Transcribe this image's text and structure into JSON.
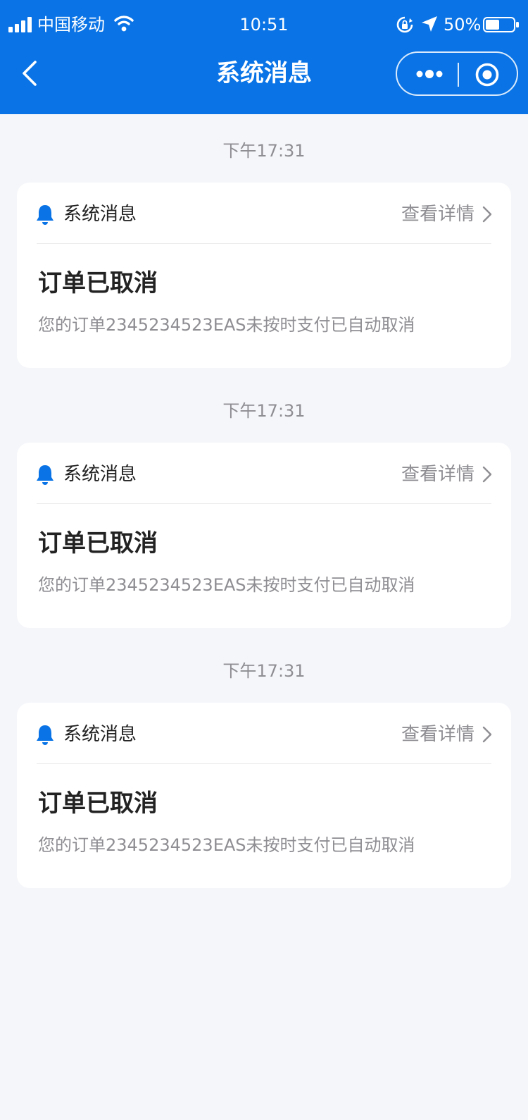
{
  "status_bar": {
    "carrier": "中国移动",
    "time": "10:51",
    "battery": "50%",
    "battery_level": 0.5
  },
  "nav": {
    "title": "系统消息",
    "more_icon": "more-dots-icon",
    "close_icon": "target-icon"
  },
  "colors": {
    "brand": "#0a74e6",
    "background": "#f5f6fa",
    "muted": "#8e8e93"
  },
  "messages": [
    {
      "time": "下午17:31",
      "category": "系统消息",
      "detail_label": "查看详情",
      "heading": "订单已取消",
      "body": "您的订单2345234523EAS未按时支付已自动取消"
    },
    {
      "time": "下午17:31",
      "category": "系统消息",
      "detail_label": "查看详情",
      "heading": "订单已取消",
      "body": "您的订单2345234523EAS未按时支付已自动取消"
    },
    {
      "time": "下午17:31",
      "category": "系统消息",
      "detail_label": "查看详情",
      "heading": "订单已取消",
      "body": "您的订单2345234523EAS未按时支付已自动取消"
    }
  ]
}
